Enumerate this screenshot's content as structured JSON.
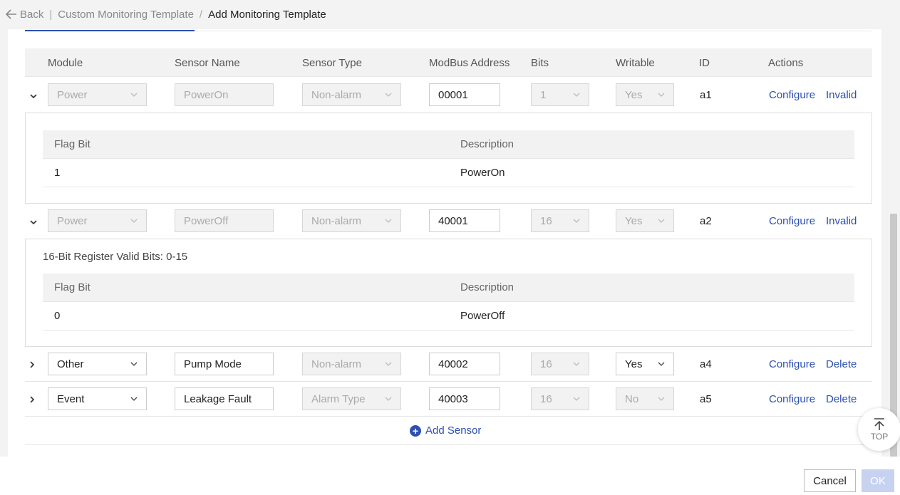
{
  "header": {
    "back_label": "Back",
    "crumb_parent": "Custom Monitoring Template",
    "crumb_separator": "/",
    "crumb_current": "Add Monitoring Template"
  },
  "table": {
    "columns": [
      "Module",
      "Sensor Name",
      "Sensor Type",
      "ModBus Address",
      "Bits",
      "Writable",
      "ID",
      "Actions"
    ],
    "rows": [
      {
        "module": "Power",
        "sensor_name": "PowerOn",
        "sensor_type": "Non-alarm",
        "address": "00001",
        "bits": "1",
        "writable": "Yes",
        "id": "a1",
        "action1": "Configure",
        "action2": "Invalid"
      },
      {
        "module": "Power",
        "sensor_name": "PowerOff",
        "sensor_type": "Non-alarm",
        "address": "40001",
        "bits": "16",
        "writable": "Yes",
        "id": "a2",
        "action1": "Configure",
        "action2": "Invalid"
      },
      {
        "module": "Other",
        "sensor_name": "Pump Mode",
        "sensor_type": "Non-alarm",
        "address": "40002",
        "bits": "16",
        "writable": "Yes",
        "id": "a4",
        "action1": "Configure",
        "action2": "Delete"
      },
      {
        "module": "Event",
        "sensor_name": "Leakage Fault",
        "sensor_type": "Alarm Type",
        "address": "40003",
        "bits": "16",
        "writable": "No",
        "id": "a5",
        "action1": "Configure",
        "action2": "Delete"
      }
    ]
  },
  "detail1": {
    "headers": [
      "Flag Bit",
      "Description"
    ],
    "rows": [
      {
        "flag": "1",
        "description": "PowerOn"
      }
    ]
  },
  "detail2": {
    "note": "16-Bit Register Valid Bits: 0-15",
    "headers": [
      "Flag Bit",
      "Description"
    ],
    "rows": [
      {
        "flag": "0",
        "description": "PowerOff"
      }
    ]
  },
  "add_sensor_label": "Add Sensor",
  "footer": {
    "cancel_label": "Cancel",
    "ok_label": "OK"
  },
  "top_button_label": "TOP",
  "colors": {
    "accent": "#2d4fb0",
    "disabled_bg": "#f2f2f2",
    "header_bg": "#f2f2f2"
  }
}
